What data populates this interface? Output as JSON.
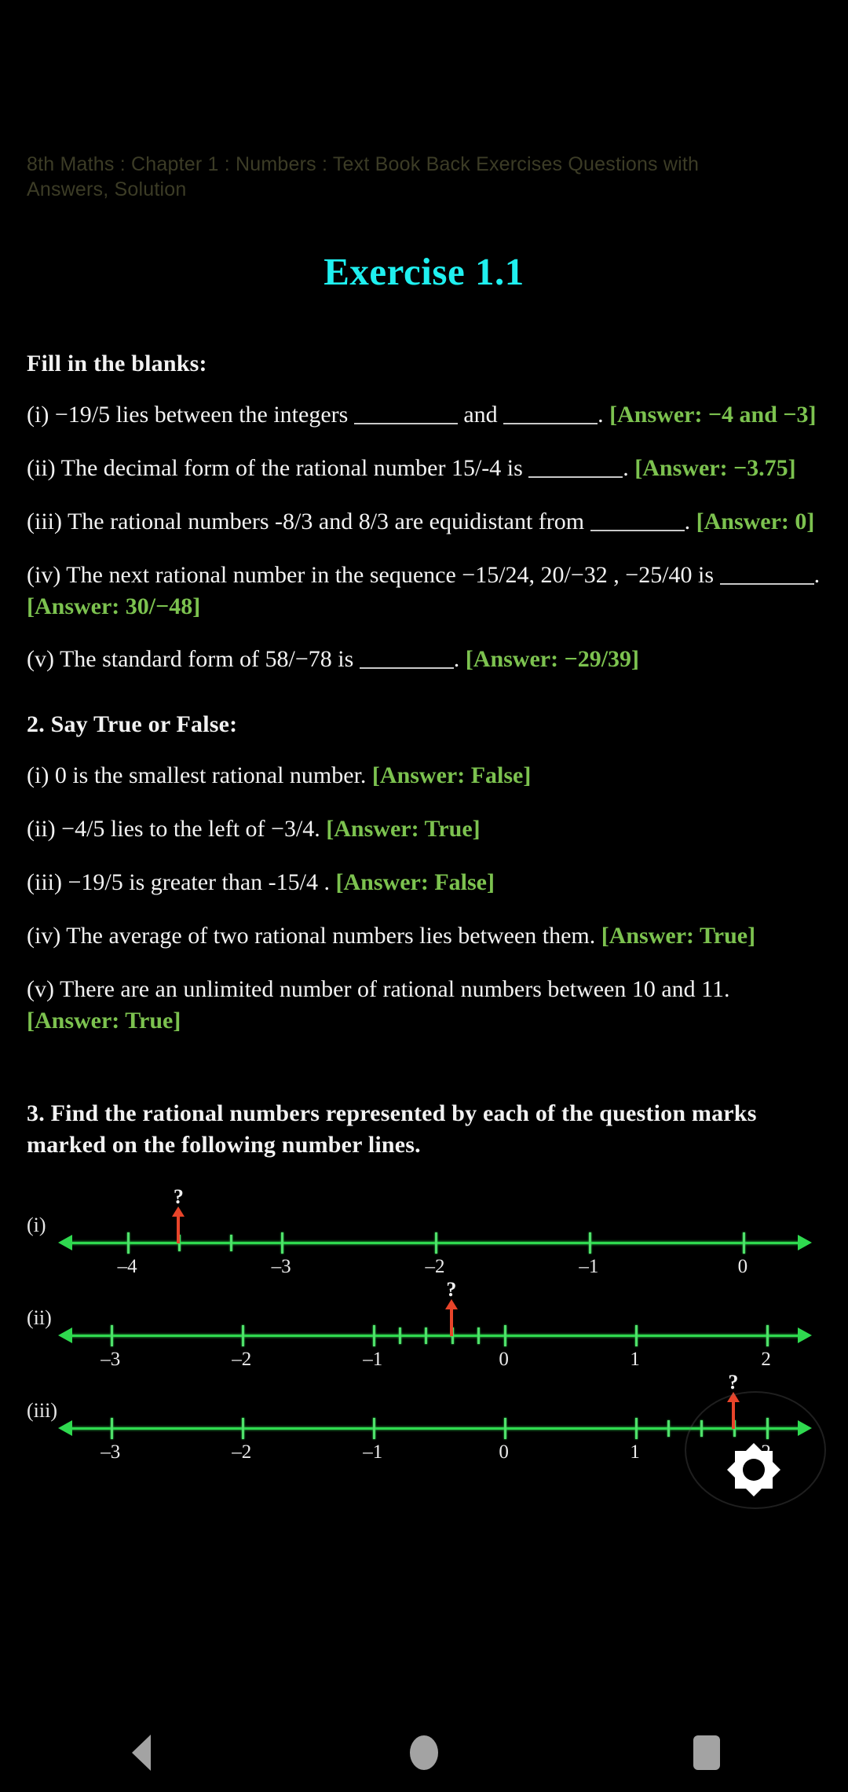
{
  "breadcrumb": "8th Maths : Chapter 1 : Numbers : Text Book Back Exercises Questions with Answers, Solution",
  "exercise_title": "Exercise 1.1",
  "section1": {
    "heading": "Fill in the blanks:",
    "items": [
      {
        "num": "(i)",
        "text_a": "−19/5 lies between the integers",
        "text_b": "and",
        "text_c": ".",
        "answer": "[Answer: −4 and −3]"
      },
      {
        "num": "(ii)",
        "text_a": "The decimal form of the rational number 15/-4 is",
        "text_b": ".",
        "answer": "[Answer: −3.75]"
      },
      {
        "num": "(iii)",
        "text_a": "The rational numbers -8/3 and 8/3 are equidistant from",
        "text_b": ".",
        "answer": "[Answer: 0]"
      },
      {
        "num": "(iv)",
        "text_a": "The next rational number in the sequence −15/24, 20/−32 , −25/40 is",
        "text_b": ".",
        "answer": "[Answer: 30/−48]"
      },
      {
        "num": "(v)",
        "text_a": "The standard form of 58/−78 is",
        "text_b": ".",
        "answer": "[Answer: −29/39]"
      }
    ]
  },
  "section2": {
    "heading": "2. Say True or False:",
    "items": [
      {
        "num": "(i)",
        "text": "0 is the smallest rational number.",
        "answer": "[Answer: False]"
      },
      {
        "num": "(ii)",
        "text": "−4/5 lies to the left of −3/4.",
        "answer": "[Answer: True]"
      },
      {
        "num": "(iii)",
        "text": "−19/5 is greater than -15/4 .",
        "answer": "[Answer: False]"
      },
      {
        "num": "(iv)",
        "text": "The average of two rational numbers lies between them.",
        "answer": "[Answer: True]"
      },
      {
        "num": "(v)",
        "text": "There are an unlimited number of rational numbers between 10 and 11.",
        "answer": "[Answer: True]"
      }
    ]
  },
  "section3": {
    "heading": "3. Find the rational numbers represented by each of the question marks marked on the following number lines.",
    "numberlines": [
      {
        "label": "(i)",
        "qmark": "?",
        "range": [
          -4.45,
          0.45
        ],
        "major_ticks": [
          -4,
          -3,
          -2,
          -1,
          0
        ],
        "major_labels": [
          "–4",
          "–3",
          "–2",
          "–1",
          "0"
        ],
        "minor_ticks": [
          -3.667,
          -3.333
        ],
        "marker_value": -3.667,
        "left_arrow": true,
        "right_arrow": true
      },
      {
        "label": "(ii)",
        "qmark": "?",
        "range": [
          -3.4,
          2.35
        ],
        "major_ticks": [
          -3,
          -2,
          -1,
          0,
          1,
          2
        ],
        "major_labels": [
          "–3",
          "–2",
          "–1",
          "0",
          "1",
          "2"
        ],
        "minor_ticks": [
          -0.8,
          -0.6,
          -0.4,
          -0.2
        ],
        "marker_value": -0.4,
        "left_arrow": true,
        "right_arrow": true
      },
      {
        "label": "(iii)",
        "qmark": "?",
        "range": [
          -3.4,
          2.35
        ],
        "major_ticks": [
          -3,
          -2,
          -1,
          0,
          1,
          2
        ],
        "major_labels": [
          "–3",
          "–2",
          "–1",
          "0",
          "1",
          "2"
        ],
        "minor_ticks": [
          1.25,
          1.5,
          1.75
        ],
        "marker_value": 1.75,
        "left_arrow": true,
        "right_arrow": true
      }
    ]
  },
  "overlay": {
    "brightness_icon": "brightness-icon"
  },
  "navbar": {
    "back": "back-icon",
    "home": "home-icon",
    "recents": "recents-icon"
  },
  "colors": {
    "background": "#000000",
    "answer_green": "#7cc24f",
    "title_cyan": "#1ff0f0",
    "breadcrumb": "#3c3c26",
    "axis_green": "#2fd94f",
    "marker_red": "#e8442a",
    "body_text": "#f2f2f2"
  }
}
